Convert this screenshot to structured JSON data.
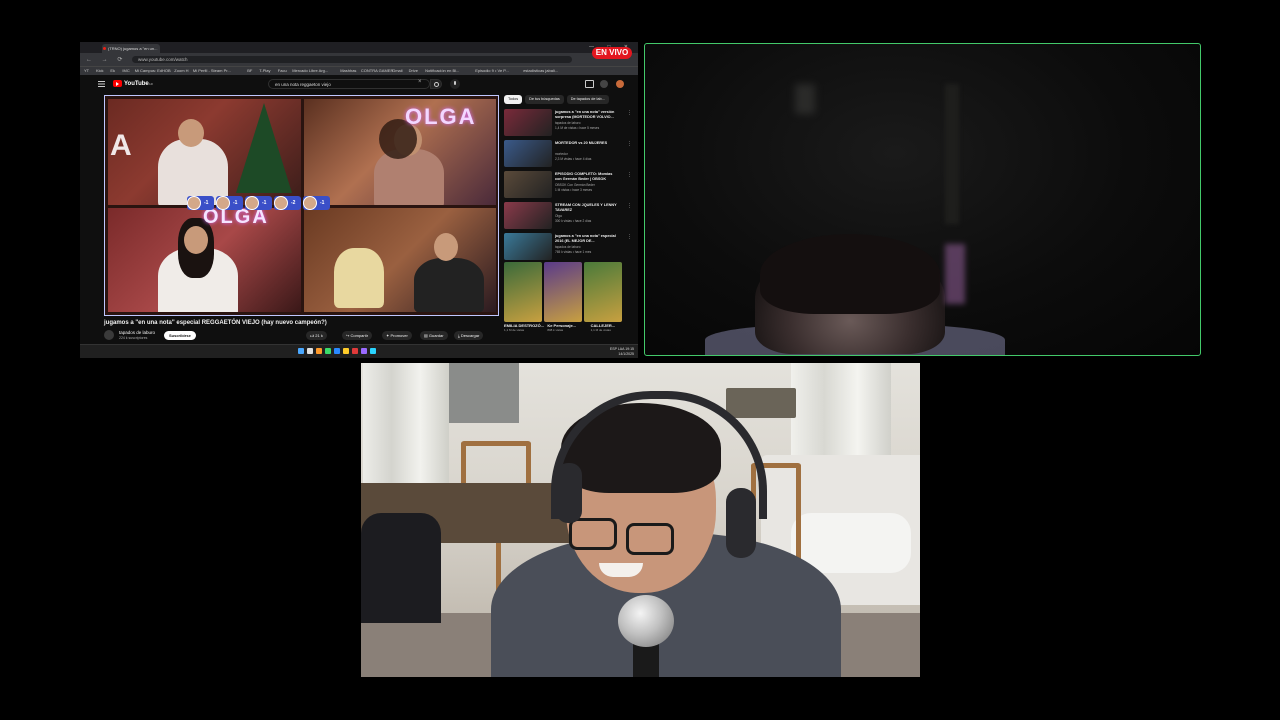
{
  "browser": {
    "tab_title": "(TRNO) jugamos a \"en un...",
    "url": "www.youtube.com/watch",
    "window_controls": "— □ ✕",
    "bookmarks": [
      "YT",
      "Kick",
      "Ek",
      "IMC",
      "Mi Campus: EdHOB",
      "Zoom H",
      "Mi Perfil - Steam Pr...",
      "BF",
      "T-Play",
      "Facu",
      "Mercado Libre Arg...",
      "Mashhas",
      "CONTRA GAMER",
      "Gmail",
      "Drive",
      "Notificación en Bl...",
      "Episodio 9 • Ve P...",
      "estadísticas jabalí..."
    ],
    "live_badge": "EN VIVO"
  },
  "youtube": {
    "logo": "YouTube",
    "logo_sup": "AR",
    "search_query": "en una nota reggaeton viejo",
    "player": {
      "overlay_sign_1": "OLGA",
      "overlay_sign_2": "OLGA",
      "scores": [
        "-1",
        "-1",
        "-1",
        "-2",
        "-1"
      ]
    },
    "video_title": "jugamos a \"en una nota\" especial REGGAETÓN VIEJO (hay nuevo campeón?)",
    "channel": {
      "name": "tapados de laburo",
      "subs": "224 k suscriptores",
      "subscribe": "Suscribirse"
    },
    "actions": {
      "likes": "21 k",
      "share": "Compartir",
      "promote": "Promover",
      "save": "Guardar",
      "download": "Descargar"
    },
    "chips": [
      "Todos",
      "De tus búsquedas",
      "De tapados de lab..."
    ],
    "recommendations": [
      {
        "title": "jugamos a \"en una nota\" versión sorpresa (MORTEDOR VOLVIO...",
        "channel": "tapados de laburo",
        "meta": "1,4 M de vistas • hace 5 meses",
        "color": "#7a2a3a"
      },
      {
        "title": "MORTEDOR vs 20 MUJERES",
        "channel": "mortedor",
        "meta": "2,3 M vistas • hace 4 días",
        "color": "#3a5a8a"
      },
      {
        "title": "EPISODIO COMPLETO: Momias con Germán Beder | OBSOK",
        "channel": "OBSOK Con Germán Beder",
        "meta": "1 M vistas • hace 3 meses",
        "color": "#5a4a3a"
      },
      {
        "title": "STREAM CON JQUELES Y LENNY TAVAREZ",
        "channel": "Olga",
        "meta": "300 k vistas • hace 2 días",
        "color": "#8a3a4a"
      },
      {
        "title": "jugamos a \"en una nota\" especial 2016 (EL MEJOR DE...",
        "channel": "tapados de laburo",
        "meta": "765 k vistas • hace 1 mes",
        "color": "#3a7a9a"
      }
    ],
    "shorts": [
      {
        "title": "EMILIA DESTROZÓ...",
        "meta": "1,1 M de vistas",
        "color": "#3a6a3a"
      },
      {
        "title": "Ke Personaje...",
        "meta": "808 k vistas",
        "color": "#5a3a8a"
      },
      {
        "title": "CALLEJER...",
        "meta": "1,1 M de vistas",
        "color": "#4a7a3a"
      }
    ]
  },
  "taskbar": {
    "lang": "ESP LAA",
    "time": "19:15",
    "date": "14/1/2025",
    "icon_colors": [
      "#4aa8ff",
      "#e0e0e0",
      "#ff9a2a",
      "#3adc6a",
      "#2a8aff",
      "#ffcc2a",
      "#e03a3a",
      "#9a6aff",
      "#2ad4ff"
    ]
  },
  "colors": {
    "cam_border_active": "#43c96a",
    "live_red": "#e3161f",
    "youtube_red": "#ff0000",
    "score_blue": "#3a4fc8"
  }
}
